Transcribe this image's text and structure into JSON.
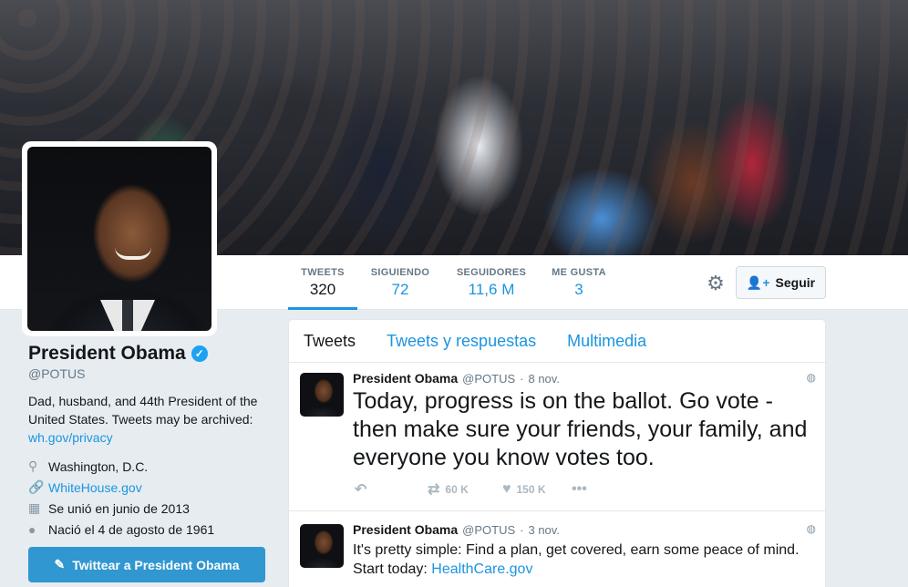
{
  "profile": {
    "name": "President Obama",
    "handle": "@POTUS",
    "bio_text": "Dad, husband, and 44th President of the United States. Tweets may be archived:",
    "bio_link": "wh.gov/privacy",
    "location": "Washington, D.C.",
    "website": "WhiteHouse.gov",
    "joined": "Se unió en junio de 2013",
    "birthday": "Nació el 4 de agosto de 1961",
    "tweet_to_label": "Twittear a President Obama"
  },
  "nav": {
    "stats": [
      {
        "label": "TWEETS",
        "value": "320"
      },
      {
        "label": "SIGUIENDO",
        "value": "72"
      },
      {
        "label": "SEGUIDORES",
        "value": "11,6 M"
      },
      {
        "label": "ME GUSTA",
        "value": "3"
      }
    ],
    "follow_label": "Seguir"
  },
  "timeline": {
    "tabs": [
      "Tweets",
      "Tweets y respuestas",
      "Multimedia"
    ]
  },
  "tweets": [
    {
      "name": "President Obama",
      "handle": "@POTUS",
      "sep": "·",
      "date": "8 nov.",
      "text": "Today, progress is on the ballot. Go vote - then make sure your friends, your family, and everyone you know votes too.",
      "retweets": "60 K",
      "likes": "150 K"
    },
    {
      "name": "President Obama",
      "handle": "@POTUS",
      "sep": "·",
      "date": "3 nov.",
      "text": "It's pretty simple: Find a plan, get covered, earn some peace of mind. Start today:",
      "link": "HealthCare.gov"
    }
  ],
  "icons": {
    "reply": "reply-icon",
    "retweet": "retweet-icon",
    "like": "heart-icon",
    "more": "more-icon",
    "globe": "globe-icon",
    "gear": "gear-icon",
    "verified": "verified-badge-icon",
    "location": "location-pin-icon",
    "link": "link-icon",
    "calendar": "calendar-icon",
    "balloon": "balloon-icon",
    "compose": "compose-icon",
    "follow": "follow-user-icon"
  },
  "colors": {
    "accent": "#1b95e0",
    "button": "#3097d1",
    "background": "#e6ecf0"
  }
}
